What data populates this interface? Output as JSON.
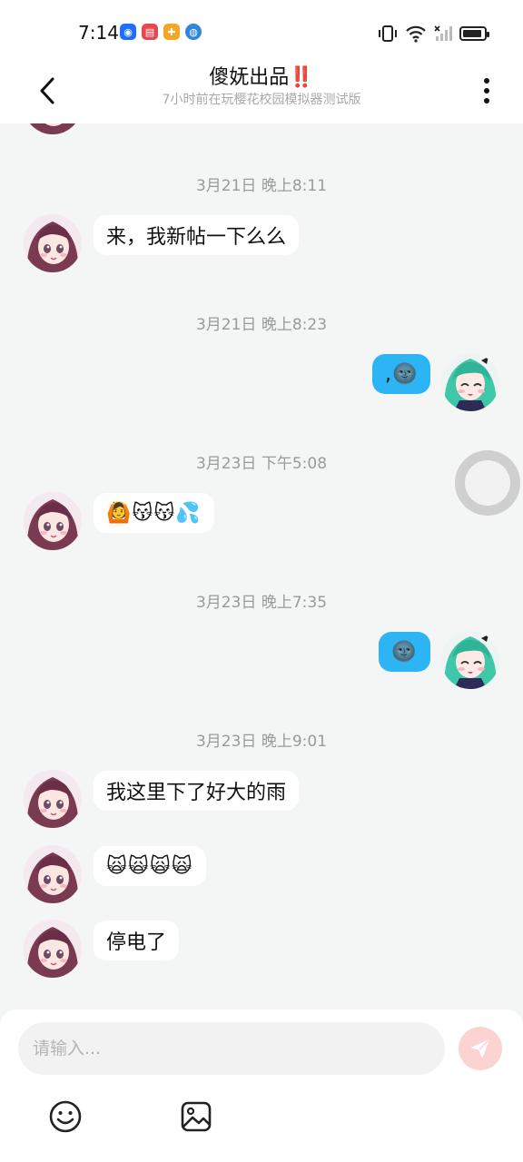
{
  "status_bar": {
    "time": "7:14",
    "apps": [
      {
        "icon": "lightbulb-app-icon",
        "color": "#1e6fff",
        "glyph": "◉"
      },
      {
        "icon": "book-app-icon",
        "color": "#e8474d",
        "glyph": "▤"
      },
      {
        "icon": "grid-app-icon",
        "color": "#f5a623",
        "glyph": "✚"
      },
      {
        "icon": "globe-app-icon",
        "color": "#2e86de",
        "glyph": "◍"
      }
    ],
    "icons": [
      "vibrate-icon",
      "wifi-icon",
      "signal-icon",
      "battery-icon"
    ],
    "battery_level": 0.9
  },
  "header": {
    "title": "傻妩出品",
    "title_mark": "‼️",
    "subtitle": "7小时前在玩樱花校园模拟器测试版"
  },
  "messages": [
    {
      "type": "timestamp",
      "text": "3月21日 晚上8:11"
    },
    {
      "type": "in",
      "text": "来，我新帖一下么么"
    },
    {
      "type": "timestamp",
      "text": "3月21日 晚上8:23"
    },
    {
      "type": "out",
      "text": ",🌚"
    },
    {
      "type": "timestamp",
      "text": "3月23日 下午5:08"
    },
    {
      "type": "in",
      "text": "🙆😽😽💦"
    },
    {
      "type": "timestamp",
      "text": "3月23日 晚上7:35"
    },
    {
      "type": "out",
      "text": "🌚"
    },
    {
      "type": "timestamp",
      "text": "3月23日 晚上9:01"
    },
    {
      "type": "in",
      "text": "我这里下了好大的雨"
    },
    {
      "type": "in",
      "text": "🙀🙀🙀🙀"
    },
    {
      "type": "in",
      "text": "停电了"
    }
  ],
  "composer": {
    "placeholder": "请输入...",
    "send_icon": "send-icon",
    "tools": [
      "emoji-icon",
      "image-icon"
    ]
  },
  "colors": {
    "outgoing_bubble": "#2db4f5",
    "incoming_bubble": "#ffffff",
    "background": "#f4f5f5",
    "send_button": "#fbd4d2"
  }
}
